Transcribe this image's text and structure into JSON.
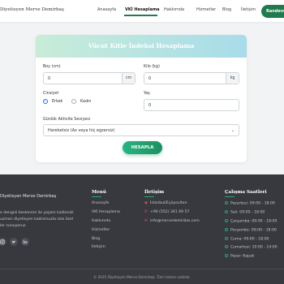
{
  "nav": {
    "brand": "Diyetisyen Merve Demirbaş",
    "links": [
      "Anasayfa",
      "VKİ Hesaplama",
      "Hakkımda",
      "Hizmetler",
      "Blog",
      "İletişim"
    ],
    "active_index": 1,
    "cta": "Randevu",
    "accent": "#1f7a4d"
  },
  "card": {
    "title": "Vücut Kitle İndeksi Hesaplama",
    "boy_label": "Boy (cm)",
    "boy_value": "0",
    "boy_unit": "cm",
    "kilo_label": "Kilo (kg)",
    "kilo_value": "0",
    "kilo_unit": "kg",
    "cinsiyet_label": "Cinsiyet",
    "gender_options": [
      "Erkek",
      "Kadın"
    ],
    "gender_selected": "Erkek",
    "yas_label": "Yaş",
    "yas_value": "0",
    "activity_label": "Günlük Aktivite Seviyesi",
    "activity_value": "Hareketsiz (Az veya hiç egzersiz)",
    "button": "HESAPLA"
  },
  "footer": {
    "brand": "Diyetisyen Merve Demirbaş",
    "desc": [
      "e dengeli beslenme ile yaşam kalitenizi",
      "uzman diyetisyen kadromuzla size özel",
      "ler sunuyoruz."
    ],
    "social_icons": [
      "instagram-icon",
      "twitter-icon",
      "linkedin-icon"
    ],
    "menu_title": "Menü",
    "menu_links": [
      "Anasayfa",
      "VKİ Hesaplama",
      "Hakkımda",
      "Hizmetler",
      "Blog",
      "İletişim"
    ],
    "contact_title": "İletişim",
    "contact": [
      "İstanbul/Eyüpsultan",
      "+90 (552) 341 69 57",
      "info@mervedemirbas.com"
    ],
    "hours_title": "Çalışma Saatleri",
    "hours": [
      "Pazartesi: 09:00 - 18:00",
      "Salı: 09:00 - 18:00",
      "Çarşamba: 09:00 - 18:00",
      "Perşembe: 09:00 - 18:00",
      "Cuma: 09:00 - 18:00",
      "Cumartesi: 10:00 - 14:00",
      "Pazar: Kapalı"
    ],
    "copyright": "© 2025 Diyetisyen Merve Demirbaş. Tüm hakları saklıdır."
  }
}
